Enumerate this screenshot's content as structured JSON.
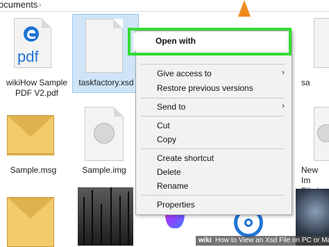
{
  "breadcrumb": {
    "text": "ocuments",
    "separator": "›"
  },
  "files": {
    "wikihow_pdf": {
      "label_line1": "wikiHow Sample",
      "label_line2": "PDF V2.pdf",
      "badge": "pdf",
      "icon": "edge-pdf-icon"
    },
    "taskfactory": {
      "label": "taskfactory.xsd"
    },
    "sample_msg": {
      "label": "Sample.msg"
    },
    "sample_img": {
      "label": "Sample.img"
    },
    "right_top": {
      "label": "sa"
    },
    "right_mid": {
      "label_line1": "New Im",
      "label_line2": "File.imc"
    }
  },
  "context_menu": {
    "open_with": "Open with",
    "give_access": "Give access to",
    "restore": "Restore previous versions",
    "send_to": "Send to",
    "cut": "Cut",
    "copy": "Copy",
    "create_shortcut": "Create shortcut",
    "delete": "Delete",
    "rename": "Rename",
    "properties": "Properties",
    "chevron": "›"
  },
  "watermark": {
    "brand": "wiki",
    "text": "How to View an Xsd File on PC or Mac"
  },
  "colors": {
    "highlight": "#33dd33",
    "selection": "#cfe5f7",
    "accent": "#1e74d6"
  }
}
